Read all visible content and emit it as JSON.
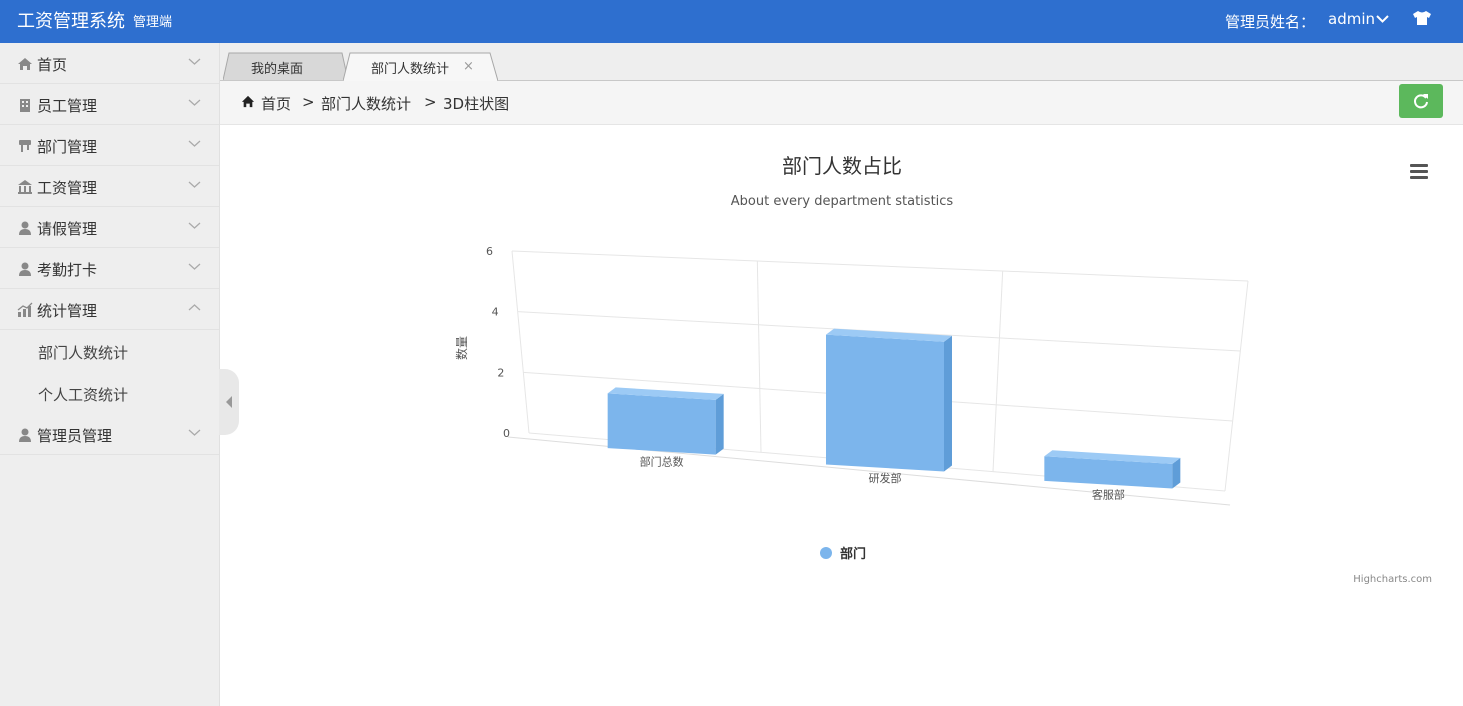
{
  "header": {
    "title": "工资管理系统",
    "subtitle": "管理端",
    "admin_label": "管理员姓名：",
    "admin_name": "admin",
    "icons": [
      "chevron-down-icon",
      "shirt-icon"
    ],
    "bg_color": "#2e6fcf"
  },
  "sidebar": {
    "items": [
      {
        "label": "首页",
        "icon": "home-icon"
      },
      {
        "label": "员工管理",
        "icon": "building-icon"
      },
      {
        "label": "部门管理",
        "icon": "tree-icon"
      },
      {
        "label": "工资管理",
        "icon": "bank-icon"
      },
      {
        "label": "请假管理",
        "icon": "user-icon"
      },
      {
        "label": "考勤打卡",
        "icon": "user-icon"
      },
      {
        "label": "统计管理",
        "icon": "bar-chart-icon",
        "expanded": true,
        "children": [
          "部门人数统计",
          "个人工资统计"
        ]
      },
      {
        "label": "管理员管理",
        "icon": "user-icon"
      }
    ]
  },
  "tabs": [
    {
      "label": "我的桌面",
      "active": false
    },
    {
      "label": "部门人数统计",
      "active": true,
      "close": "×"
    }
  ],
  "breadcrumb": {
    "items": [
      "首页",
      "部门人数统计",
      "3D柱状图"
    ],
    "separator": ">"
  },
  "refresh": {
    "color": "#5cb85c",
    "icon": "refresh-icon"
  },
  "chart_data": {
    "type": "bar",
    "title": "部门人数占比",
    "subtitle": "About every department statistics",
    "ylabel": "数量",
    "xlabel": "",
    "categories": [
      "部门总数",
      "研发部",
      "客服部"
    ],
    "series": [
      {
        "name": "部门",
        "values": [
          2,
          5,
          1
        ],
        "color": "#7cb5ec"
      }
    ],
    "ylim": [
      0,
      6
    ],
    "yticks": [
      0,
      2,
      4,
      6
    ],
    "legend": "bottom-center",
    "grid": true,
    "credits": "Highcharts.com",
    "menu_icon": "menu-icon"
  }
}
